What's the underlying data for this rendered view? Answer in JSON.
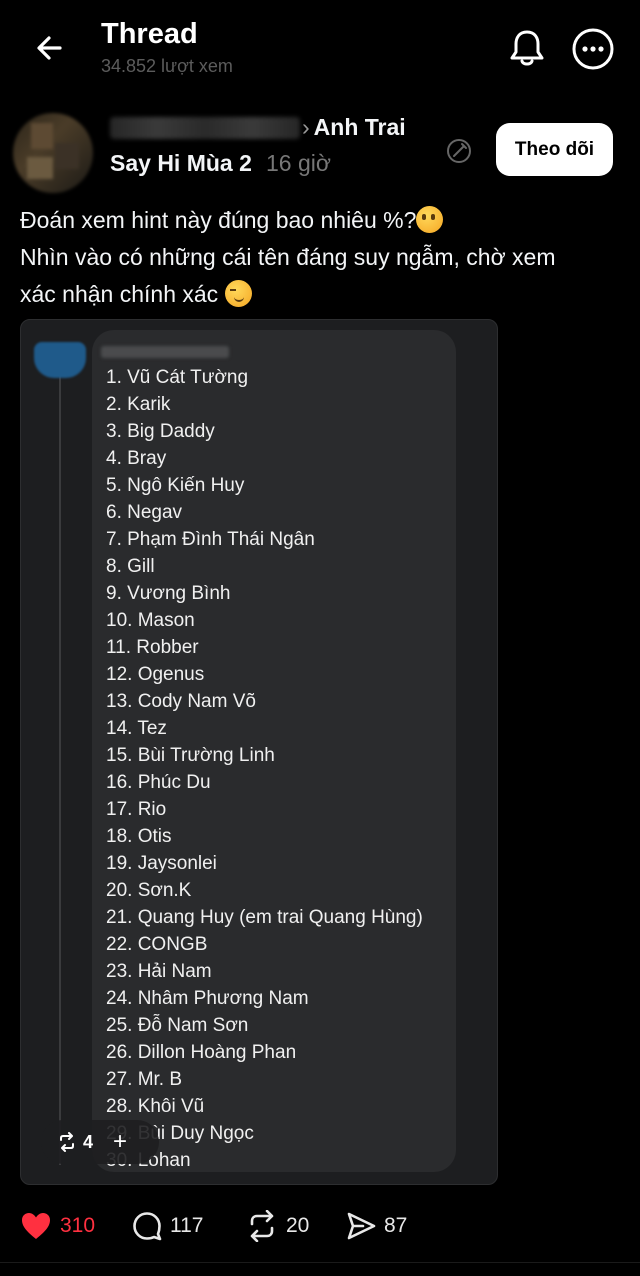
{
  "header": {
    "title": "Thread",
    "views": "34.852 lượt xem"
  },
  "post": {
    "community_line1": "Anh Trai",
    "community_line2": "Say Hi Mùa 2",
    "time": "16 giờ",
    "follow_label": "Theo dõi",
    "text_line1": "Đoán xem hint này đúng bao nhiêu %?",
    "text_line2": "Nhìn vào có những cái tên đáng suy ngẫm, chờ xem",
    "text_line3": "xác nhận chính xác",
    "emoji1": "thinking-face",
    "emoji2": "winking-face",
    "image_names": [
      "1. Vũ Cát Tường",
      "2. Karik",
      "3. Big Daddy",
      "4. Bray",
      "5. Ngô Kiến Huy",
      "6. Negav",
      "7. Phạm Đình Thái Ngân",
      "8. Gill",
      "9. Vương Bình",
      "10. Mason",
      "11. Robber",
      "12. Ogenus",
      "13. Cody Nam Võ",
      "14. Tez",
      "15. Bùi Trường Linh",
      "16. Phúc Du",
      "17. Rio",
      "18. Otis",
      "19. Jaysonlei",
      "20. Sơn.K",
      "21. Quang Huy (em trai Quang Hùng)",
      "22. CONGB",
      "23. Hải Nam",
      "24. Nhâm Phương Nam",
      "25. Đỗ Nam Sơn",
      "26. Dillon Hoàng Phan",
      "27. Mr. B",
      "28. Khôi Vũ",
      "29. Bùi Duy Ngọc",
      "30. Lohan"
    ],
    "image_repost_count": "4"
  },
  "actions": {
    "likes": "310",
    "comments": "117",
    "reposts": "20",
    "shares": "87"
  },
  "colors": {
    "background": "#000000",
    "like_red": "#ff3040",
    "follow_bg": "#ffffff"
  }
}
